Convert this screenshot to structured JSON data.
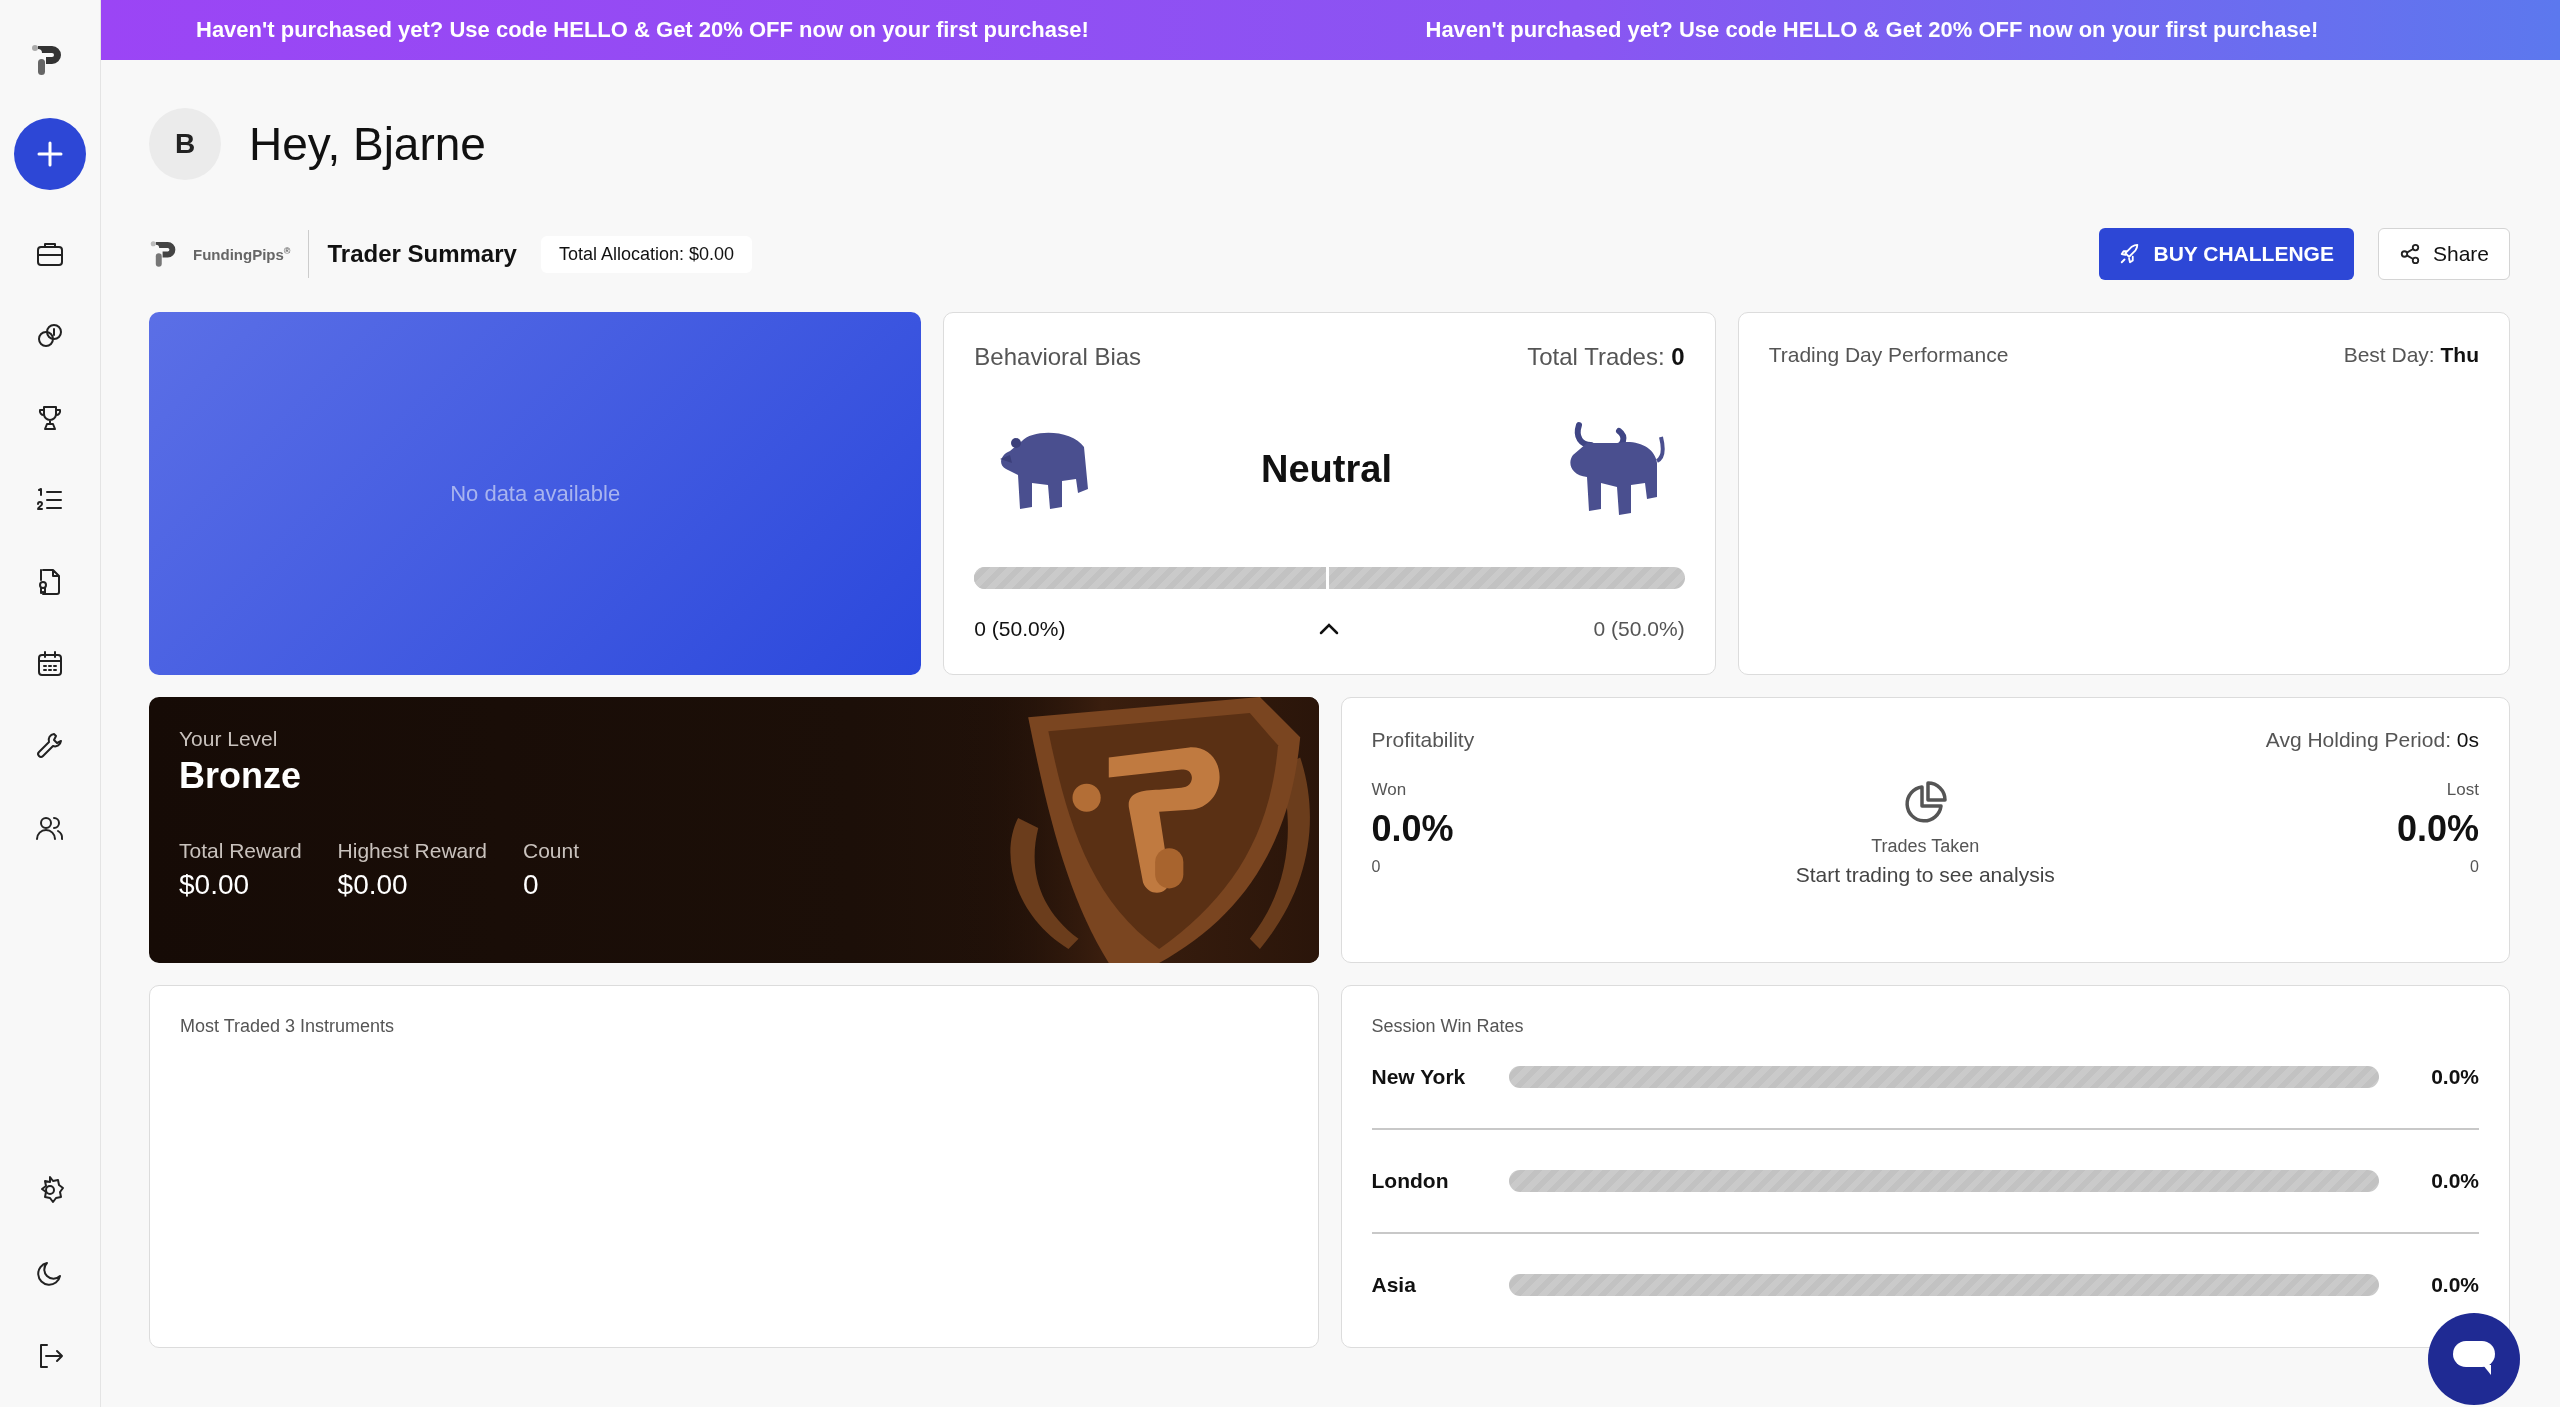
{
  "banner": {
    "messages": [
      "Haven't purchased yet? Use code HELLO & Get 20% OFF now on your first purchase!",
      "Haven't purchased yet? Use code HELLO & Get 20% OFF now on your first purchase!"
    ]
  },
  "greeting": {
    "avatar": "B",
    "text": "Hey, Bjarne"
  },
  "summary_bar": {
    "brand": "FundingPips$^{®}$",
    "title": "Trader Summary",
    "allocation": "Total Allocation: $0.00",
    "buttons": [
      {
        "label": "BUY CHALLENGE",
        "kind": "primary"
      },
      {
        "label": "Share",
        "kind": "secondary"
      }
    ]
  },
  "balance_card": {
    "message": "No data available"
  },
  "behavioral_bias": {
    "title": "Behavioral Bias",
    "total_label": "Total Trades:",
    "total_value": "0",
    "verdict": "Neutral",
    "level": 0.5,
    "bear_reading": "0 (50.0%)",
    "bull_reading": "0 (50.0%)"
  },
  "trading_day": {
    "title": "Trading Day Performance",
    "best_label": "Best Day:",
    "best_value": "Thu"
  },
  "level_card": {
    "label": "Your Level",
    "tier": "Bronze",
    "stats": [
      {
        "label": "Total Reward",
        "value": "$0.00"
      },
      {
        "label": "Highest Reward",
        "value": "$0.00"
      },
      {
        "label": "Count",
        "value": "0"
      }
    ]
  },
  "profitability": {
    "title": "Profitability",
    "avg_label": "Avg Holding Period:",
    "avg_value": "0s",
    "won": {
      "label": "Won",
      "percent": "0.0%",
      "count": "0"
    },
    "center": {
      "label": "Trades Taken",
      "message": "Start trading to see analysis"
    },
    "lost": {
      "label": "Lost",
      "percent": "0.0%",
      "count": "0"
    }
  },
  "instruments": {
    "title": "Most Traded 3 Instruments"
  },
  "sessions": {
    "title": "Session Win Rates",
    "rows": [
      {
        "name": "New York",
        "level": 0,
        "reading": "0.0%"
      },
      {
        "name": "London",
        "level": 0,
        "reading": "0.0%"
      },
      {
        "name": "Asia",
        "level": 0,
        "reading": "0.0%"
      }
    ]
  }
}
